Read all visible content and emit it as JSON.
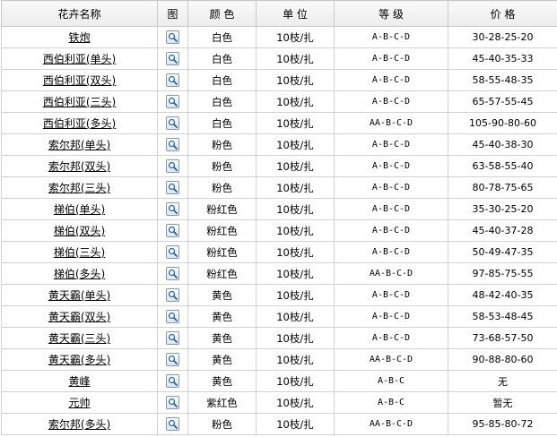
{
  "headers": {
    "name": "花卉名称",
    "image": "图",
    "color": "颜 色",
    "unit": "单 位",
    "grade": "等 级",
    "price": "价 格"
  },
  "rows": [
    {
      "name": "铁炮",
      "color": "白色",
      "unit": "10枝/扎",
      "grade": "A-B-C-D",
      "price": "30-28-25-20"
    },
    {
      "name": "西伯利亚(单头)",
      "color": "白色",
      "unit": "10枝/扎",
      "grade": "A-B-C-D",
      "price": "45-40-35-33"
    },
    {
      "name": "西伯利亚(双头)",
      "color": "白色",
      "unit": "10枝/扎",
      "grade": "A-B-C-D",
      "price": "58-55-48-35"
    },
    {
      "name": "西伯利亚(三头)",
      "color": "白色",
      "unit": "10枝/扎",
      "grade": "A-B-C-D",
      "price": "65-57-55-45"
    },
    {
      "name": "西伯利亚(多头)",
      "color": "白色",
      "unit": "10枝/扎",
      "grade": "AA-B-C-D",
      "price": "105-90-80-60"
    },
    {
      "name": "索尔邦(单头)",
      "color": "粉色",
      "unit": "10枝/扎",
      "grade": "A-B-C-D",
      "price": "45-40-38-30"
    },
    {
      "name": "索尔邦(双头)",
      "color": "粉色",
      "unit": "10枝/扎",
      "grade": "A-B-C-D",
      "price": "63-58-55-40"
    },
    {
      "name": "索尔邦(三头)",
      "color": "粉色",
      "unit": "10枝/扎",
      "grade": "A-B-C-D",
      "price": "80-78-75-65"
    },
    {
      "name": "梯伯(单头)",
      "color": "粉红色",
      "unit": "10枝/扎",
      "grade": "A-B-C-D",
      "price": "35-30-25-20"
    },
    {
      "name": "梯伯(双头)",
      "color": "粉红色",
      "unit": "10枝/扎",
      "grade": "A-B-C-D",
      "price": "45-40-37-28"
    },
    {
      "name": "梯伯(三头)",
      "color": "粉红色",
      "unit": "10枝/扎",
      "grade": "A-B-C-D",
      "price": "50-49-47-35"
    },
    {
      "name": "梯伯(多头)",
      "color": "粉红色",
      "unit": "10枝/扎",
      "grade": "AA-B-C-D",
      "price": "97-85-75-55"
    },
    {
      "name": "黄天霸(单头)",
      "color": "黄色",
      "unit": "10枝/扎",
      "grade": "A-B-C-D",
      "price": "48-42-40-35"
    },
    {
      "name": "黄天霸(双头)",
      "color": "黄色",
      "unit": "10枝/扎",
      "grade": "A-B-C-D",
      "price": "58-53-48-45"
    },
    {
      "name": "黄天霸(三头)",
      "color": "黄色",
      "unit": "10枝/扎",
      "grade": "A-B-C-D",
      "price": "73-68-57-50"
    },
    {
      "name": "黄天霸(多头)",
      "color": "黄色",
      "unit": "10枝/扎",
      "grade": "AA-B-C-D",
      "price": "90-88-80-60"
    },
    {
      "name": "黄峰",
      "color": "黄色",
      "unit": "10枝/扎",
      "grade": "A-B-C",
      "price": "无"
    },
    {
      "name": "元帅",
      "color": "紫红色",
      "unit": "10枝/扎",
      "grade": "A-B-C",
      "price": "暂无"
    },
    {
      "name": "索尔邦(多头)",
      "color": "粉色",
      "unit": "10枝/扎",
      "grade": "AA-B-C-D",
      "price": "95-85-80-72"
    }
  ],
  "icons": {
    "view_image": "magnifier-icon"
  }
}
